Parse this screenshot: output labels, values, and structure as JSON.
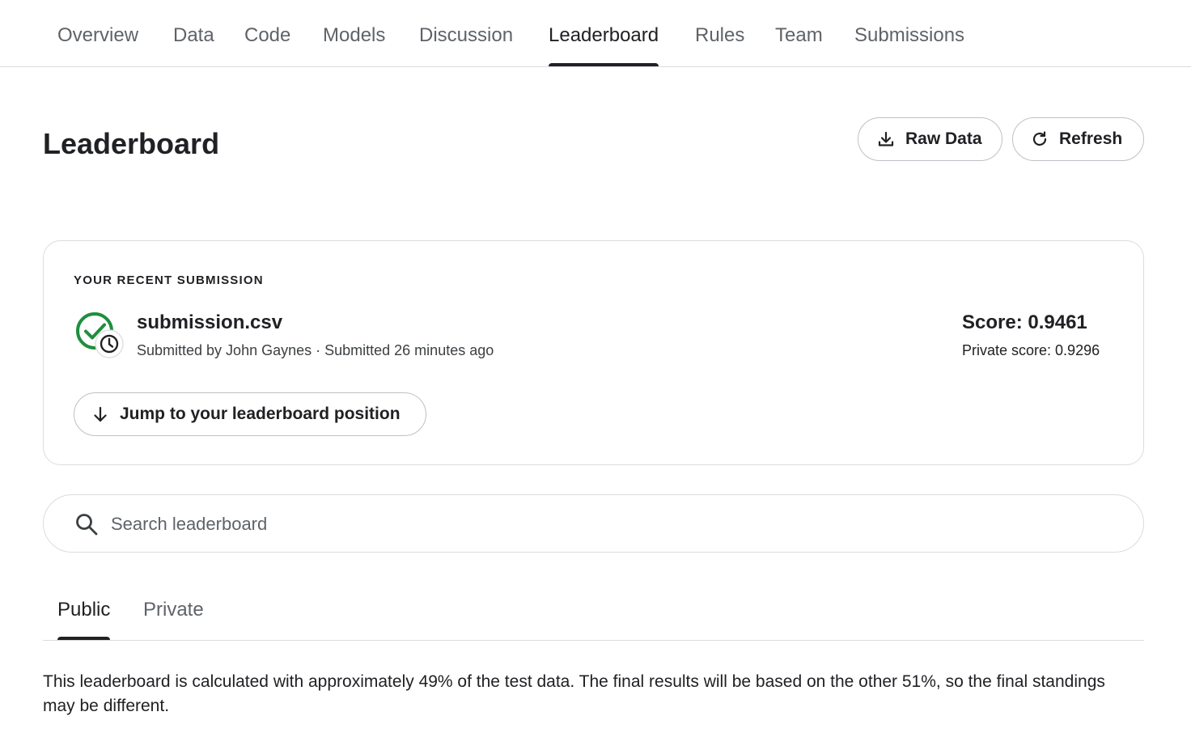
{
  "nav": {
    "tabs": [
      {
        "label": "Overview"
      },
      {
        "label": "Data"
      },
      {
        "label": "Code"
      },
      {
        "label": "Models"
      },
      {
        "label": "Discussion"
      },
      {
        "label": "Leaderboard",
        "active": true
      },
      {
        "label": "Rules"
      },
      {
        "label": "Team"
      },
      {
        "label": "Submissions"
      }
    ]
  },
  "header": {
    "title": "Leaderboard",
    "raw_data_label": "Raw Data",
    "raw_data_icon": "download-icon",
    "refresh_label": "Refresh",
    "refresh_icon": "refresh-icon"
  },
  "recent_submission": {
    "section_label": "YOUR RECENT SUBMISSION",
    "status_icon": "check-clock-icon",
    "file_name": "submission.csv",
    "meta": "Submitted by John Gaynes · Submitted 26 minutes ago",
    "score": "Score: 0.9461",
    "private_score": "Private score: 0.9296",
    "jump_label": "Jump to your leaderboard position",
    "jump_icon": "arrow-down-icon"
  },
  "search": {
    "placeholder": "Search leaderboard",
    "value": "",
    "icon": "search-icon"
  },
  "board_tabs": [
    {
      "label": "Public",
      "active": true
    },
    {
      "label": "Private",
      "active": false
    }
  ],
  "note": "This leaderboard is calculated with approximately 49% of the test data. The final results will be based on the other 51%, so the final standings may be different.",
  "colors": {
    "success_green": "#1e8e3e",
    "text_primary": "#202124",
    "text_secondary": "#5f6368",
    "border": "#dadce0"
  }
}
